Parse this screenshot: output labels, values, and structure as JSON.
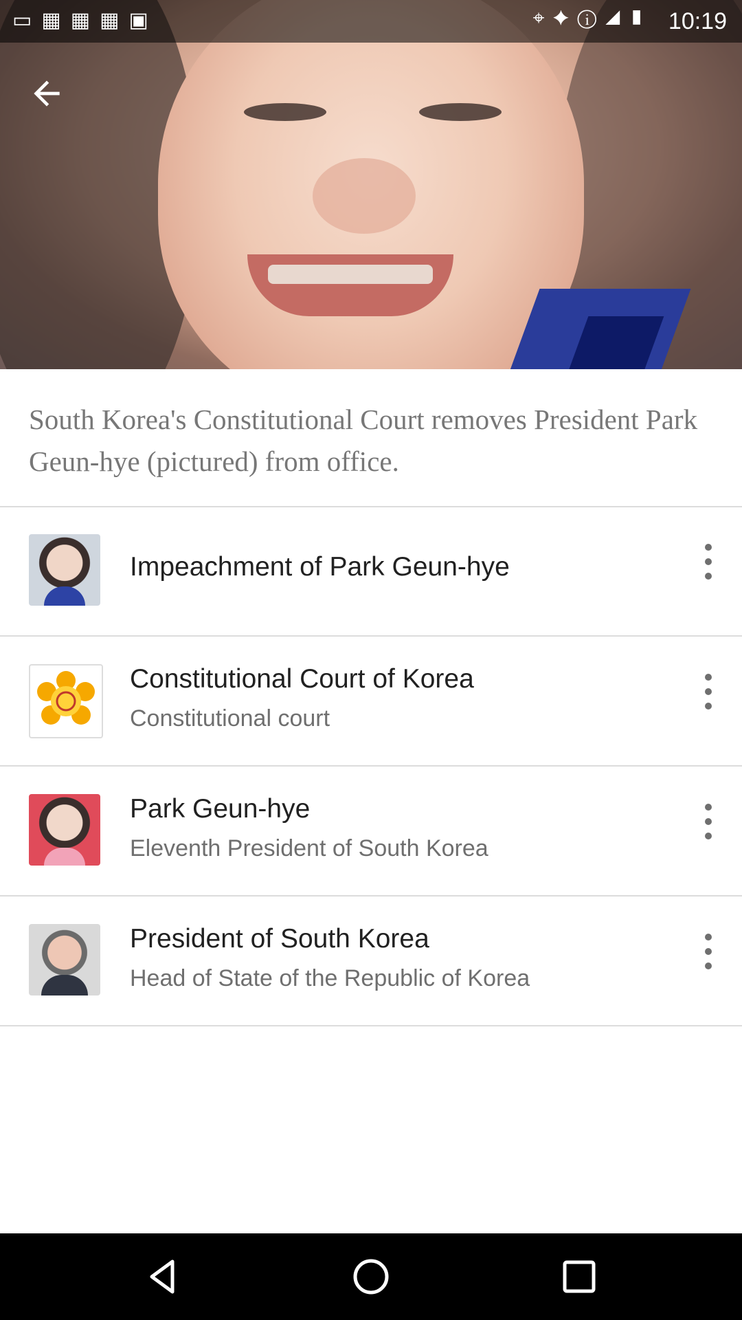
{
  "status_bar": {
    "time": "10:19",
    "left_icons": [
      "message-icon",
      "photo-icon",
      "photo-icon",
      "photo-icon",
      "news-icon"
    ],
    "right_icons": [
      "fake-gps-icon",
      "satellite-icon",
      "alert-icon",
      "signal-icon",
      "battery-icon"
    ]
  },
  "header": {
    "back_icon": "arrow-left-icon"
  },
  "caption": "South Korea's Constitutional Court removes President Park Geun-hye (pictured) from office.",
  "items": [
    {
      "title": "Impeachment of Park Geun-hye",
      "subtitle": ""
    },
    {
      "title": "Constitutional Court of Korea",
      "subtitle": "Constitutional court"
    },
    {
      "title": "Park Geun-hye",
      "subtitle": "Eleventh President of South Korea"
    },
    {
      "title": "President of South Korea",
      "subtitle": "Head of State of the Republic of Korea"
    }
  ],
  "nav": {
    "back": "back-triangle-icon",
    "home": "home-circle-icon",
    "recents": "recents-square-icon"
  },
  "colors": {
    "title_text": "#212121",
    "subtitle_text": "#6f6f6f",
    "caption_text": "#777777",
    "divider": "#dcdcdc"
  }
}
